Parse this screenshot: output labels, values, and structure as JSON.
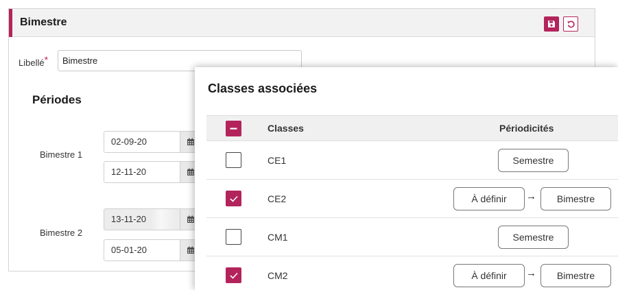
{
  "panel": {
    "title": "Bimestre",
    "accent_color": "#b3245c",
    "save_icon": "floppy-disk-icon",
    "reset_icon": "undo-icon"
  },
  "form": {
    "libelle_label": "Libellé",
    "required_marker": "*",
    "libelle_value": "Bimestre"
  },
  "periods": {
    "title": "Périodes",
    "items": [
      {
        "label": "Bimestre 1",
        "start": "02-09-20",
        "end": "12-11-20",
        "start_disabled": false
      },
      {
        "label": "Bimestre 2",
        "start": "13-11-20",
        "end": "05-01-20",
        "start_disabled": true
      }
    ]
  },
  "classes_popup": {
    "title": "Classes associées",
    "col_classes": "Classes",
    "col_periodicites": "Périodicités",
    "rows": [
      {
        "name": "CE1",
        "checked": false,
        "periodicite": "Semestre"
      },
      {
        "name": "CE2",
        "checked": true,
        "from": "À définir",
        "to": "Bimestre"
      },
      {
        "name": "CM1",
        "checked": false,
        "periodicite": "Semestre"
      },
      {
        "name": "CM2",
        "checked": true,
        "from": "À définir",
        "to": "Bimestre"
      }
    ],
    "arrow": "→"
  }
}
